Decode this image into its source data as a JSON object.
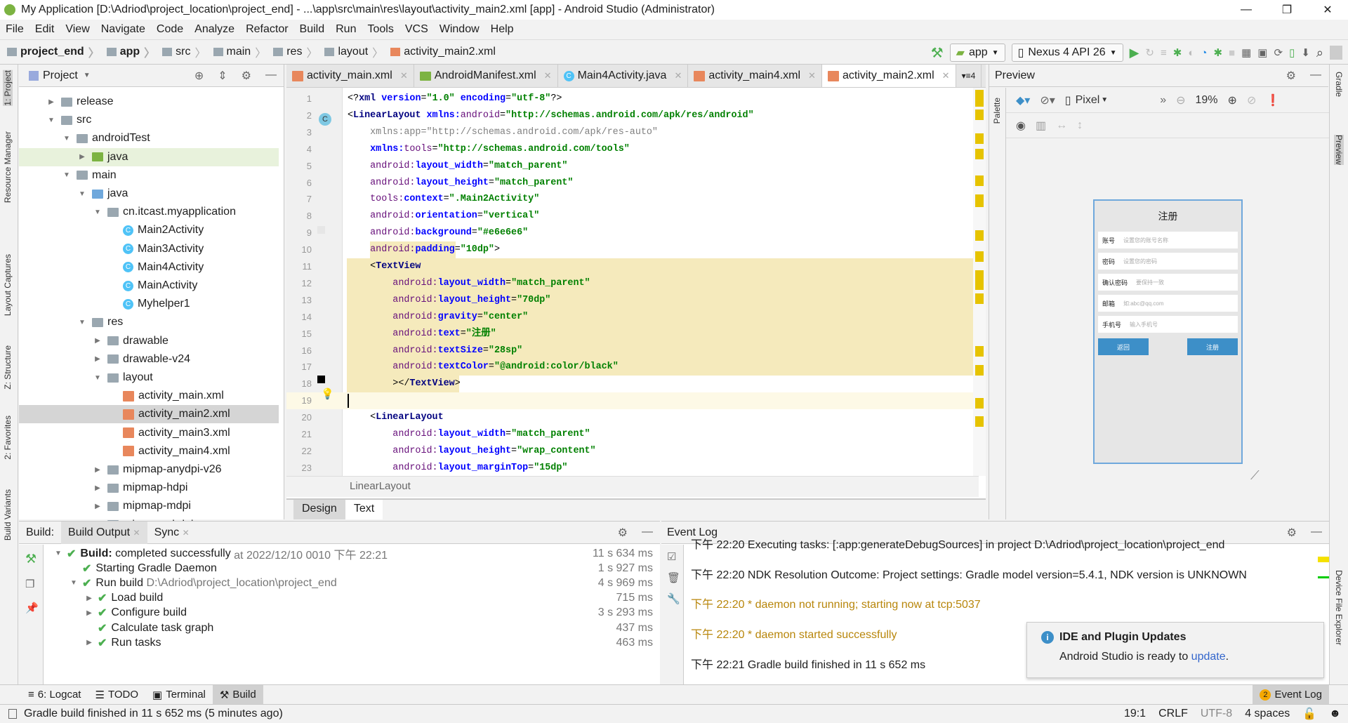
{
  "window": {
    "title": "My Application [D:\\Adriod\\project_location\\project_end] - ...\\app\\src\\main\\res\\layout\\activity_main2.xml [app] - Android Studio (Administrator)",
    "minimize": "—",
    "maximize": "❐",
    "close": "✕"
  },
  "menu": [
    "File",
    "Edit",
    "View",
    "Navigate",
    "Code",
    "Analyze",
    "Refactor",
    "Build",
    "Run",
    "Tools",
    "VCS",
    "Window",
    "Help"
  ],
  "breadcrumb": [
    "project_end",
    "app",
    "src",
    "main",
    "res",
    "layout",
    "activity_main2.xml"
  ],
  "toolbar": {
    "config": "app",
    "device": "Nexus 4 API 26"
  },
  "left_strip": [
    "1: Project",
    "Resource Manager",
    "Layout Captures",
    "Z: Structure",
    "2: Favorites",
    "Build Variants"
  ],
  "right_strip": [
    "Gradle",
    "Preview",
    "Device File Explorer"
  ],
  "project": {
    "title": "Project",
    "tree": [
      {
        "label": "release",
        "level": 0,
        "arrow": "▶",
        "icon": "folder"
      },
      {
        "label": "src",
        "level": 0,
        "arrow": "▼",
        "icon": "folder"
      },
      {
        "label": "androidTest",
        "level": 1,
        "arrow": "▼",
        "icon": "folder"
      },
      {
        "label": "java",
        "level": 2,
        "arrow": "▶",
        "icon": "src",
        "state": "hl"
      },
      {
        "label": "main",
        "level": 1,
        "arrow": "▼",
        "icon": "folder"
      },
      {
        "label": "java",
        "level": 2,
        "arrow": "▼",
        "icon": "blue"
      },
      {
        "label": "cn.itcast.myapplication",
        "level": 3,
        "arrow": "▼",
        "icon": "folder"
      },
      {
        "label": "Main2Activity",
        "level": 4,
        "arrow": "",
        "icon": "cls"
      },
      {
        "label": "Main3Activity",
        "level": 4,
        "arrow": "",
        "icon": "cls"
      },
      {
        "label": "Main4Activity",
        "level": 4,
        "arrow": "",
        "icon": "cls"
      },
      {
        "label": "MainActivity",
        "level": 4,
        "arrow": "",
        "icon": "cls"
      },
      {
        "label": "Myhelper1",
        "level": 4,
        "arrow": "",
        "icon": "cls"
      },
      {
        "label": "res",
        "level": 2,
        "arrow": "▼",
        "icon": "folder"
      },
      {
        "label": "drawable",
        "level": 3,
        "arrow": "▶",
        "icon": "folder"
      },
      {
        "label": "drawable-v24",
        "level": 3,
        "arrow": "▶",
        "icon": "folder"
      },
      {
        "label": "layout",
        "level": 3,
        "arrow": "▼",
        "icon": "folder"
      },
      {
        "label": "activity_main.xml",
        "level": 4,
        "arrow": "",
        "icon": "xml"
      },
      {
        "label": "activity_main2.xml",
        "level": 4,
        "arrow": "",
        "icon": "xml",
        "state": "sel"
      },
      {
        "label": "activity_main3.xml",
        "level": 4,
        "arrow": "",
        "icon": "xml"
      },
      {
        "label": "activity_main4.xml",
        "level": 4,
        "arrow": "",
        "icon": "xml"
      },
      {
        "label": "mipmap-anydpi-v26",
        "level": 3,
        "arrow": "▶",
        "icon": "folder"
      },
      {
        "label": "mipmap-hdpi",
        "level": 3,
        "arrow": "▶",
        "icon": "folder"
      },
      {
        "label": "mipmap-mdpi",
        "level": 3,
        "arrow": "▶",
        "icon": "folder"
      },
      {
        "label": "mipmap-xhdpi",
        "level": 3,
        "arrow": "▶",
        "icon": "folder"
      }
    ]
  },
  "editor": {
    "tabs": [
      {
        "label": "activity_main.xml",
        "icon": "xml"
      },
      {
        "label": "AndroidManifest.xml",
        "icon": "mf"
      },
      {
        "label": "Main4Activity.java",
        "icon": "cls"
      },
      {
        "label": "activity_main4.xml",
        "icon": "xml"
      },
      {
        "label": "activity_main2.xml",
        "icon": "xml",
        "active": true
      }
    ],
    "tab_overflow": "▾≡4",
    "lines": [
      [
        [
          "punc",
          "<?"
        ],
        [
          "tag",
          "xml "
        ],
        [
          "attr",
          "version"
        ],
        [
          "punc",
          "="
        ],
        [
          "val",
          "\"1.0\" "
        ],
        [
          "attr",
          "encoding"
        ],
        [
          "punc",
          "="
        ],
        [
          "val",
          "\"utf-8\""
        ],
        [
          "punc",
          "?>"
        ]
      ],
      [
        [
          "punc",
          "<"
        ],
        [
          "tag",
          "LinearLayout "
        ],
        [
          "attr",
          "xmlns:"
        ],
        [
          "ns",
          "android"
        ],
        [
          "punc",
          "="
        ],
        [
          "val",
          "\"http://schemas.android.com/apk/res/android\""
        ]
      ],
      [
        [
          "grey",
          "    xmlns:app=\"http://schemas.android.com/apk/res-auto\""
        ]
      ],
      [
        [
          "attr",
          "    xmlns:"
        ],
        [
          "ns",
          "tools"
        ],
        [
          "punc",
          "="
        ],
        [
          "val",
          "\"http://schemas.android.com/tools\""
        ]
      ],
      [
        [
          "ns",
          "    android:"
        ],
        [
          "attr",
          "layout_width"
        ],
        [
          "punc",
          "="
        ],
        [
          "val",
          "\"match_parent\""
        ]
      ],
      [
        [
          "ns",
          "    android:"
        ],
        [
          "attr",
          "layout_height"
        ],
        [
          "punc",
          "="
        ],
        [
          "val",
          "\"match_parent\""
        ]
      ],
      [
        [
          "ns",
          "    tools:"
        ],
        [
          "attr",
          "context"
        ],
        [
          "punc",
          "="
        ],
        [
          "val",
          "\".Main2Activity\""
        ]
      ],
      [
        [
          "ns",
          "    android:"
        ],
        [
          "attr",
          "orientation"
        ],
        [
          "punc",
          "="
        ],
        [
          "val",
          "\"vertical\""
        ]
      ],
      [
        [
          "ns",
          "    android:"
        ],
        [
          "attr",
          "background"
        ],
        [
          "punc",
          "="
        ],
        [
          "val",
          "\"#e6e6e6\""
        ]
      ],
      [
        [
          "ns",
          "    android:"
        ],
        [
          "attr",
          "padding"
        ],
        [
          "punc",
          "="
        ],
        [
          "val",
          "\"10dp\""
        ],
        [
          "punc",
          ">"
        ]
      ],
      [
        [
          "punc",
          "    <"
        ],
        [
          "tag",
          "TextView"
        ]
      ],
      [
        [
          "ns",
          "        android:"
        ],
        [
          "attr",
          "layout_width"
        ],
        [
          "punc",
          "="
        ],
        [
          "val",
          "\"match_parent\""
        ]
      ],
      [
        [
          "ns",
          "        android:"
        ],
        [
          "attr",
          "layout_height"
        ],
        [
          "punc",
          "="
        ],
        [
          "val",
          "\"70dp\""
        ]
      ],
      [
        [
          "ns",
          "        android:"
        ],
        [
          "attr",
          "gravity"
        ],
        [
          "punc",
          "="
        ],
        [
          "val",
          "\"center\""
        ]
      ],
      [
        [
          "ns",
          "        android:"
        ],
        [
          "attr",
          "text"
        ],
        [
          "punc",
          "="
        ],
        [
          "val",
          "\"注册\""
        ]
      ],
      [
        [
          "ns",
          "        android:"
        ],
        [
          "attr",
          "textSize"
        ],
        [
          "punc",
          "="
        ],
        [
          "val",
          "\"28sp\""
        ]
      ],
      [
        [
          "ns",
          "        android:"
        ],
        [
          "attr",
          "textColor"
        ],
        [
          "punc",
          "="
        ],
        [
          "val",
          "\"@android:color/black\""
        ]
      ],
      [
        [
          "punc",
          "        ></"
        ],
        [
          "tag",
          "TextView"
        ],
        [
          "punc",
          ">"
        ]
      ],
      [],
      [
        [
          "punc",
          "    <"
        ],
        [
          "tag",
          "LinearLayout"
        ]
      ],
      [
        [
          "ns",
          "        android:"
        ],
        [
          "attr",
          "layout_width"
        ],
        [
          "punc",
          "="
        ],
        [
          "val",
          "\"match_parent\""
        ]
      ],
      [
        [
          "ns",
          "        android:"
        ],
        [
          "attr",
          "layout_height"
        ],
        [
          "punc",
          "="
        ],
        [
          "val",
          "\"wrap_content\""
        ]
      ],
      [
        [
          "ns",
          "        android:"
        ],
        [
          "attr",
          "layout_marginTop"
        ],
        [
          "punc",
          "="
        ],
        [
          "val",
          "\"15dp\""
        ]
      ]
    ],
    "structure_crumb": "LinearLayout",
    "mode_tabs": {
      "design": "Design",
      "text": "Text"
    }
  },
  "preview": {
    "title": "Preview",
    "palette": "Palette",
    "device": "Pixel",
    "zoom": "19%",
    "phone": {
      "title": "注册",
      "fields": [
        {
          "label": "账号",
          "hint": "设置您的账号名称"
        },
        {
          "label": "密码",
          "hint": "设置您的密码"
        },
        {
          "label": "确认密码",
          "hint": "要保持一致"
        },
        {
          "label": "邮箱",
          "hint": "如:abc@qq.com"
        },
        {
          "label": "手机号",
          "hint": "输入手机号"
        }
      ],
      "back": "返回",
      "register": "注册",
      "accent": "#3d8fc8"
    }
  },
  "build": {
    "prefix": "Build:",
    "tabs": [
      "Build Output",
      "Sync"
    ],
    "rows": [
      {
        "level": 0,
        "arrow": "▼",
        "bold": "Build:",
        "text": " completed successfully",
        "extra": " at 2022/12/10 0010 下午 22:21",
        "time": "11 s 634 ms"
      },
      {
        "level": 1,
        "arrow": "",
        "text": "Starting Gradle Daemon",
        "time": "1 s 927 ms"
      },
      {
        "level": 1,
        "arrow": "▼",
        "text": "Run build",
        "extra": " D:\\Adriod\\project_location\\project_end",
        "time": "4 s 969 ms"
      },
      {
        "level": 2,
        "arrow": "▶",
        "text": "Load build",
        "time": "715 ms"
      },
      {
        "level": 2,
        "arrow": "▶",
        "text": "Configure build",
        "time": "3 s 293 ms"
      },
      {
        "level": 2,
        "arrow": "",
        "text": "Calculate task graph",
        "time": "437 ms"
      },
      {
        "level": 2,
        "arrow": "▶",
        "text": "Run tasks",
        "time": "463 ms"
      }
    ]
  },
  "event_log": {
    "title": "Event Log",
    "entries": [
      {
        "text": "下午 22:20 Executing tasks: [:app:generateDebugSources] in project D:\\Adriod\\project_location\\project_end",
        "kind": "normal"
      },
      {
        "text": "下午 22:20 NDK Resolution Outcome: Project settings: Gradle model version=5.4.1, NDK version is UNKNOWN",
        "kind": "normal"
      },
      {
        "text": "下午 22:20 * daemon not running; starting now at tcp:5037",
        "kind": "warn"
      },
      {
        "text": "下午 22:20 * daemon started successfully",
        "kind": "warn"
      },
      {
        "text": "下午 22:21 Gradle build finished in 11 s 652 ms",
        "kind": "normal"
      }
    ],
    "notification": {
      "title": "IDE and Plugin Updates",
      "body": "Android Studio is ready to ",
      "link": "update",
      "tail": "."
    }
  },
  "bottom_tabs": {
    "logcat": "6: Logcat",
    "todo": "TODO",
    "terminal": "Terminal",
    "build": "Build",
    "event_log": "Event Log",
    "event_count": "2"
  },
  "status": {
    "message": "Gradle build finished in 11 s 652 ms (5 minutes ago)",
    "position": "19:1",
    "line_sep": "CRLF",
    "encoding": "UTF-8",
    "indent": "4 spaces"
  }
}
